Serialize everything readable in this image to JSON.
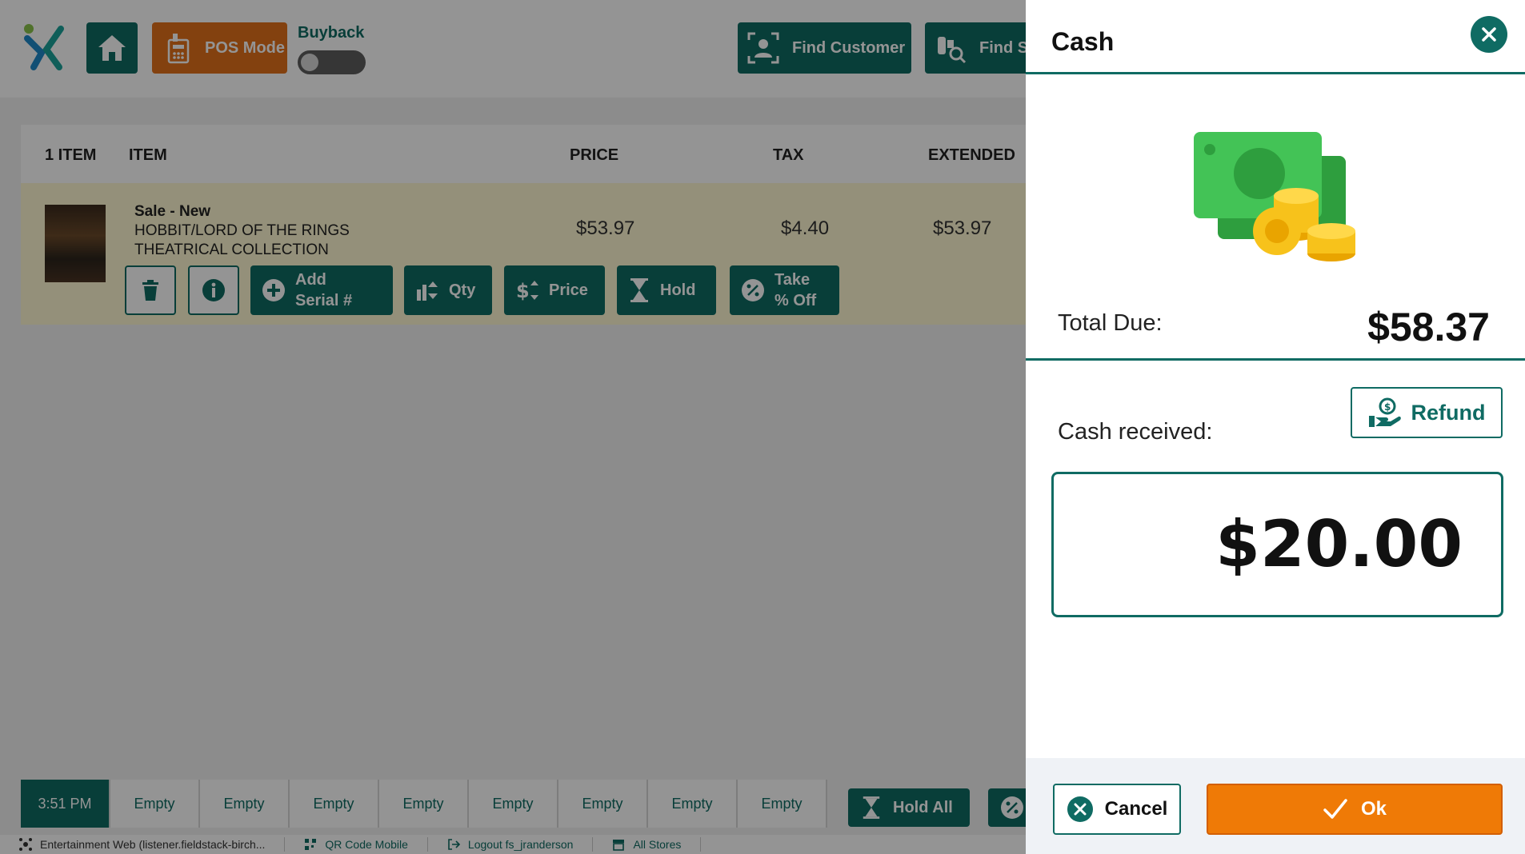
{
  "colors": {
    "brand": "#0f6b63",
    "accent": "#e2701a",
    "ok": "#ef7a06",
    "row_highlight": "#fff9d2"
  },
  "topbar": {
    "pos_mode_label": "POS Mode",
    "buyback_label": "Buyback",
    "find_customer_label": "Find Customer",
    "find_s_label": "Find S"
  },
  "table": {
    "headers": {
      "count": "1 ITEM",
      "item": "ITEM",
      "price": "PRICE",
      "tax": "TAX",
      "extended": "EXTENDED"
    },
    "row": {
      "sale_type": "Sale - New",
      "title_line1": "HOBBIT/LORD OF THE RINGS",
      "title_line2": "THEATRICAL COLLECTION",
      "price": "$53.97",
      "tax": "$4.40",
      "extended": "$53.97"
    },
    "actions": {
      "add_serial_1": "Add",
      "add_serial_2": "Serial #",
      "qty": "Qty",
      "price": "Price",
      "hold": "Hold",
      "take_1": "Take",
      "take_2": "% Off"
    }
  },
  "tabs": [
    "3:51 PM",
    "Empty",
    "Empty",
    "Empty",
    "Empty",
    "Empty",
    "Empty",
    "Empty",
    "Empty"
  ],
  "hold_all_label": "Hold All",
  "statusbar": {
    "app": "Entertainment Web (listener.fieldstack-birch...",
    "qr": "QR Code Mobile",
    "logout": "Logout fs_jranderson",
    "stores": "All Stores"
  },
  "panel": {
    "title": "Cash",
    "total_label": "Total Due:",
    "total_value": "$58.37",
    "refund_label": "Refund",
    "cash_label": "Cash received:",
    "cash_value": "$20.00",
    "cancel_label": "Cancel",
    "ok_label": "Ok"
  }
}
